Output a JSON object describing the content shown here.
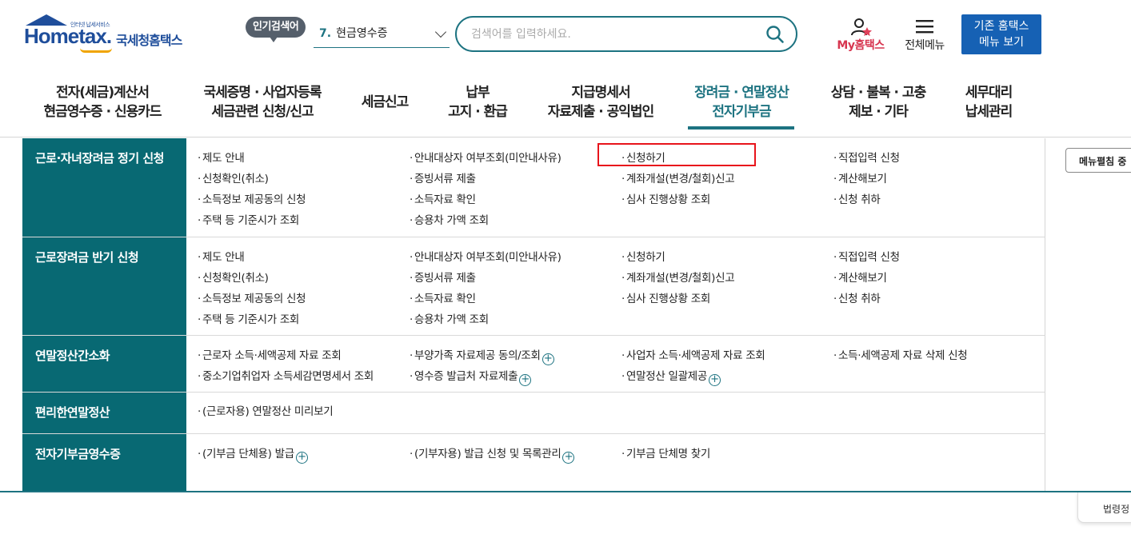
{
  "header": {
    "logo": {
      "small_text": "인터넷 납세서비스",
      "brand": "Hometax.",
      "brand_ko": "국세청홈택스"
    },
    "popular": {
      "badge": "인기검색어",
      "rank": "7.",
      "term": "현금영수증"
    },
    "search": {
      "placeholder": "검색어를 입력하세요."
    },
    "my_hometax": "My홈택스",
    "all_menu": "전체메뉴",
    "legacy": {
      "line1": "기존 홈택스",
      "line2": "메뉴 보기"
    }
  },
  "gnb": [
    {
      "line1": "전자(세금)계산서",
      "line2": "현금영수증 · 신용카드"
    },
    {
      "line1": "국세증명 · 사업자등록",
      "line2": "세금관련 신청/신고"
    },
    {
      "line1": "세금신고",
      "line2": ""
    },
    {
      "line1": "납부",
      "line2": "고지 · 환급"
    },
    {
      "line1": "지급명세서",
      "line2": "자료제출 · 공익법인"
    },
    {
      "line1": "장려금 · 연말정산",
      "line2": "전자기부금"
    },
    {
      "line1": "상담 · 불복 · 고충",
      "line2": "제보 · 기타"
    },
    {
      "line1": "세무대리",
      "line2": "납세관리"
    }
  ],
  "sections": [
    {
      "title": "근로·자녀장려금 정기 신청",
      "links": [
        "제도 안내",
        "안내대상자 여부조회(미안내사유)",
        "신청하기",
        "직접입력 신청",
        "신청확인(취소)",
        "증빙서류 제출",
        "계좌개설(변경/철회)신고",
        "계산해보기",
        "소득정보 제공동의 신청",
        "소득자료 확인",
        "심사 진행상황 조회",
        "신청 취하",
        "주택 등 기준시가 조회",
        "승용차 가액 조회"
      ]
    },
    {
      "title": "근로장려금 반기 신청",
      "links": [
        "제도 안내",
        "안내대상자 여부조회(미안내사유)",
        "신청하기",
        "직접입력 신청",
        "신청확인(취소)",
        "증빙서류 제출",
        "계좌개설(변경/철회)신고",
        "계산해보기",
        "소득정보 제공동의 신청",
        "소득자료 확인",
        "심사 진행상황 조회",
        "신청 취하",
        "주택 등 기준시가 조회",
        "승용차 가액 조회"
      ]
    },
    {
      "title": "연말정산간소화",
      "links": [
        "근로자 소득·세액공제 자료 조회",
        "부양가족 자료제공 동의/조회",
        "사업자 소득·세액공제 자료 조회",
        "소득·세액공제 자료 삭제 신청",
        "중소기업취업자 소득세감면명세서 조회",
        "영수증 발급처 자료제출",
        "연말정산 일괄제공"
      ]
    },
    {
      "title": "편리한연말정산",
      "links": [
        "(근로자용) 연말정산 미리보기"
      ]
    },
    {
      "title": "전자기부금영수증",
      "links": [
        "(기부금 단체용) 발급",
        "(기부자용) 발급 신청 및 목록관리",
        "기부금 단체명 찾기"
      ]
    }
  ],
  "side": {
    "collapse": "메뉴펼침 중",
    "card_label": "법령정"
  }
}
